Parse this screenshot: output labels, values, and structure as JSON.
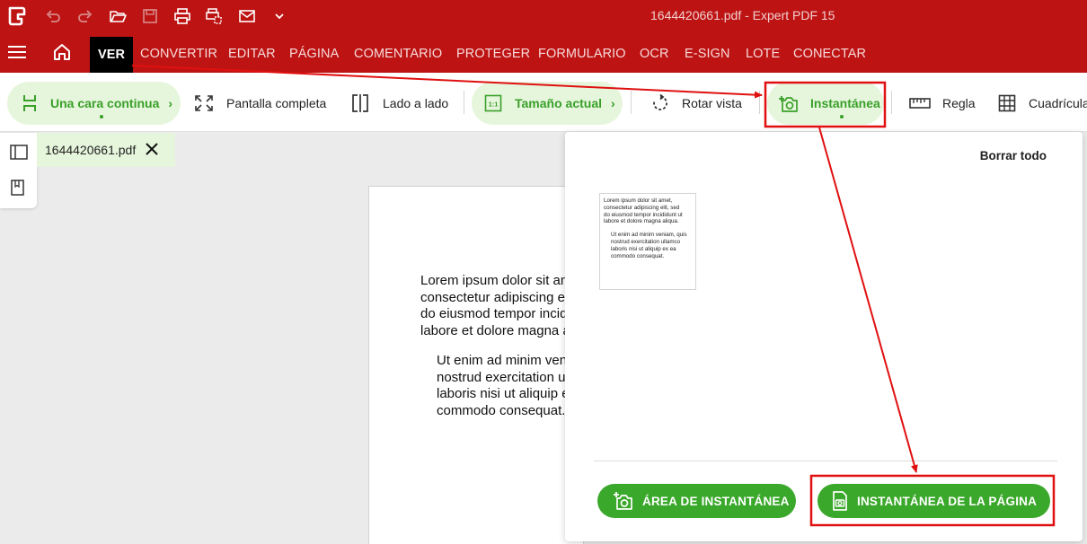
{
  "app": {
    "title": "1644420661.pdf   -   Expert PDF 15",
    "quick_access_icons": [
      "undo-icon",
      "redo-icon",
      "open-folder-icon",
      "save-icon",
      "print-icon",
      "print-settings-icon",
      "mail-icon",
      "chevron-down-icon"
    ]
  },
  "menu": {
    "items": [
      {
        "label": "VER",
        "active": true
      },
      {
        "label": "CONVERTIR"
      },
      {
        "label": "EDITAR"
      },
      {
        "label": "PÁGINA"
      },
      {
        "label": "COMENTARIO"
      },
      {
        "label": "PROTEGER"
      },
      {
        "label": "FORMULARIO"
      },
      {
        "label": "OCR"
      },
      {
        "label": "E-SIGN"
      },
      {
        "label": "LOTE"
      },
      {
        "label": "CONECTAR"
      }
    ]
  },
  "toolbar": {
    "single_continuous": "Una cara continua",
    "full_screen": "Pantalla completa",
    "side_by_side": "Lado a lado",
    "actual_size": "Tamaño actual",
    "rotate_view": "Rotar vista",
    "snapshot": "Instantánea",
    "ruler": "Regla",
    "grid": "Cuadrícula",
    "actual_size_icon_text": "1:1"
  },
  "document_tab": {
    "filename": "1644420661.pdf"
  },
  "page": {
    "paragraph1": "Lorem ipsum dolor sit amet,\nconsectetur adipiscing elit, sed\ndo eiusmod tempor incididunt ut\nlabore et dolore magna aliqua.",
    "paragraph2": "Ut enim ad minim veniam, quis\nnostrud exercitation ullamco\nlaboris nisi ut aliquip ex ea\ncommodo consequat."
  },
  "snapshot_panel": {
    "clear_all": "Borrar todo",
    "thumb_paragraph1": "Lorem ipsum dolor sit amet,\nconsectetur adipiscing elit, sed\ndo eiusmod tempor incididunt ut\nlabore et dolore magna aliqua.",
    "thumb_paragraph2": "Ut enim ad minim veniam, quis\nnostrud exercitation ullamco\nlaboris nisi ut aliquip ex ea\ncommodo consequat.",
    "area_snapshot_button": "ÁREA DE INSTANTÁNEA",
    "page_snapshot_button": "INSTANTÁNEA DE LA PÁGINA"
  },
  "colors": {
    "brand_red": "#bd1313",
    "accent_green": "#3aa82a",
    "green_tint": "#e6f6dc",
    "annotation_red": "#e01010"
  }
}
